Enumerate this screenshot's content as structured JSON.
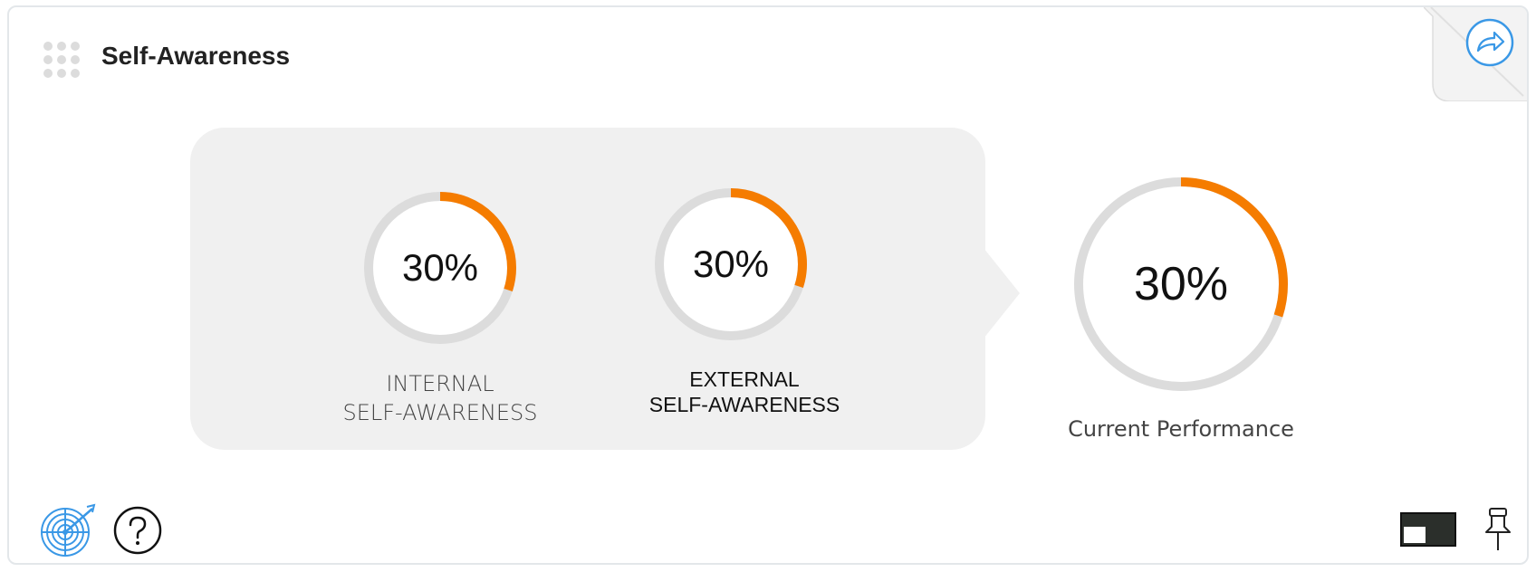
{
  "widget": {
    "title": "Self-Awareness"
  },
  "colors": {
    "accent": "#f57c00",
    "track": "#dcdcdc",
    "panel": "#f0f0f0",
    "icon_blue": "#3a98e6"
  },
  "metrics": {
    "internal": {
      "value": 30,
      "display": "30%",
      "label_line1": "INTERNAL",
      "label_line2": "SELF-AWARENESS"
    },
    "external": {
      "value": 30,
      "display": "30%",
      "label_line1": "EXTERNAL",
      "label_line2": "SELF-AWARENESS"
    },
    "current": {
      "value": 30,
      "display": "30%",
      "label": "Current Performance"
    }
  },
  "icons": {
    "drag": "drag-handle-icon",
    "share": "share-arrow-icon",
    "target": "target-icon",
    "help": "help-icon",
    "layout": "layout-toggle-icon",
    "pin": "pushpin-icon"
  }
}
